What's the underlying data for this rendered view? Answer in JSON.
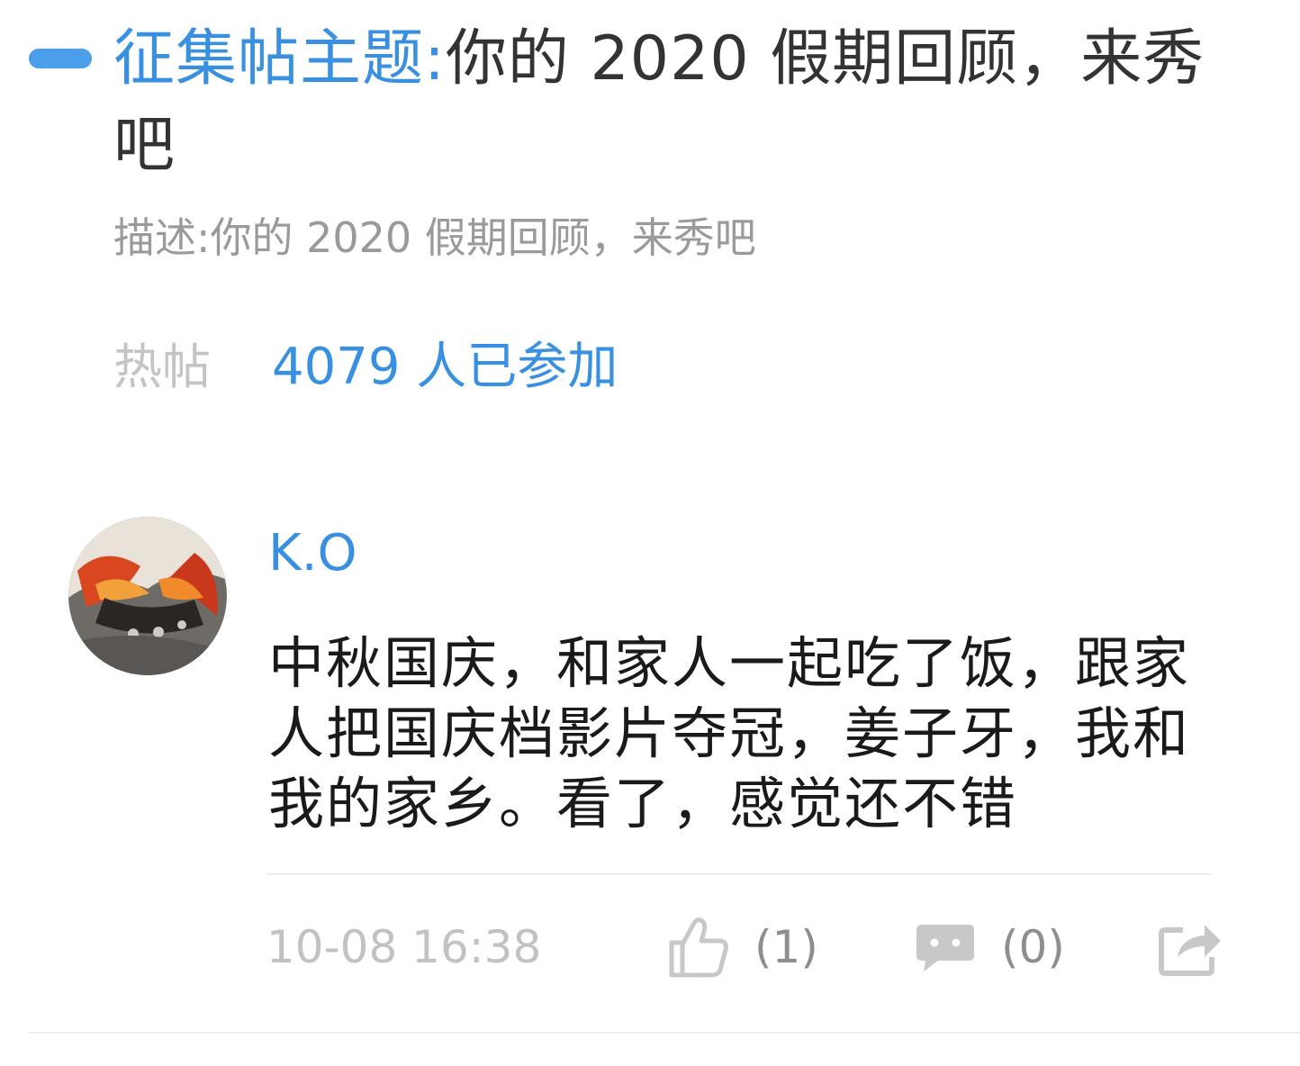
{
  "topic": {
    "prefix": "征集帖主题:",
    "title": "你的 2020 假期回顾，来秀吧",
    "description": "描述:你的 2020 假期回顾，来秀吧"
  },
  "hot": {
    "label": "热帖",
    "participants": "4079 人已参加"
  },
  "post": {
    "username": "K.O",
    "content": "中秋国庆，和家人一起吃了饭，跟家人把国庆档影片夺冠，姜子牙，我和我的家乡。看了，感觉还不错",
    "timestamp": "10-08 16:38",
    "likes": "(1)",
    "comments": "(0)"
  },
  "colors": {
    "accent": "#3a90e0",
    "muted": "#9a9a9a",
    "icon": "#c8c8c8"
  },
  "icons": {
    "like": "thumbs-up-icon",
    "comment": "comment-bubble-icon",
    "share": "share-icon"
  }
}
